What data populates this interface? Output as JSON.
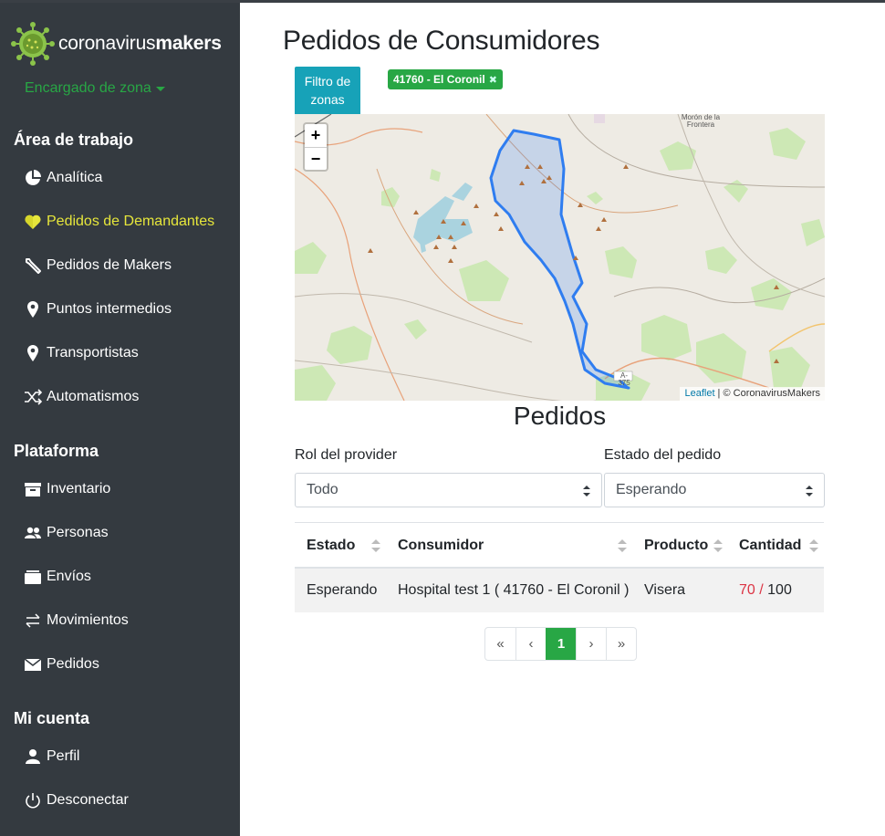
{
  "brand": {
    "prefix": "coronavirus",
    "suffix": "makers"
  },
  "role": {
    "label": "Encargado de zona"
  },
  "sidebar": {
    "sections": [
      {
        "title": "Área de trabajo"
      },
      {
        "title": "Plataforma"
      },
      {
        "title": "Mi cuenta"
      }
    ],
    "items": [
      {
        "label": "Analítica",
        "icon": "pie-chart-icon"
      },
      {
        "label": "Pedidos de Demandantes",
        "icon": "heart-icon",
        "active": true
      },
      {
        "label": "Pedidos de Makers",
        "icon": "wrench-icon"
      },
      {
        "label": "Puntos intermedios",
        "icon": "map-marker-icon"
      },
      {
        "label": "Transportistas",
        "icon": "map-marker-icon"
      },
      {
        "label": "Automatismos",
        "icon": "shuffle-icon"
      },
      {
        "label": "Inventario",
        "icon": "archive-icon"
      },
      {
        "label": "Personas",
        "icon": "users-icon"
      },
      {
        "label": "Envíos",
        "icon": "box-icon"
      },
      {
        "label": "Movimientos",
        "icon": "exchange-icon"
      },
      {
        "label": "Pedidos",
        "icon": "envelope-icon"
      },
      {
        "label": "Perfil",
        "icon": "user-icon"
      },
      {
        "label": "Desconectar",
        "icon": "power-icon"
      }
    ]
  },
  "main": {
    "title": "Pedidos de Consumidores",
    "filter_button": "Filtro de zonas",
    "zone_badge": "41760 - El Coronil",
    "map": {
      "zoom_in": "+",
      "zoom_out": "−",
      "attribution_link": "Leaflet",
      "attribution_text": " | © CoronavirusMakers",
      "town_label": "Morón de la Frontera",
      "road_label": "A-375"
    },
    "section_title": "Pedidos",
    "filters": {
      "role_label": "Rol del provider",
      "role_value": "Todo",
      "status_label": "Estado del pedido",
      "status_value": "Esperando"
    },
    "table": {
      "columns": [
        "Estado",
        "Consumidor",
        "Producto",
        "Cantidad"
      ],
      "rows": [
        {
          "estado": "Esperando",
          "consumidor": "Hospital test 1 ( 41760 - El Coronil )",
          "producto": "Visera",
          "cantidad_actual": "70",
          "cantidad_sep": " / ",
          "cantidad_total": "100"
        }
      ]
    },
    "pagination": [
      "«",
      "‹",
      "1",
      "›",
      "»"
    ]
  },
  "colors": {
    "sidebar_bg": "#343a40",
    "accent_green": "#28a745",
    "active_yellow": "#e6e63b",
    "info": "#17a2b8",
    "danger": "#dc3545"
  }
}
